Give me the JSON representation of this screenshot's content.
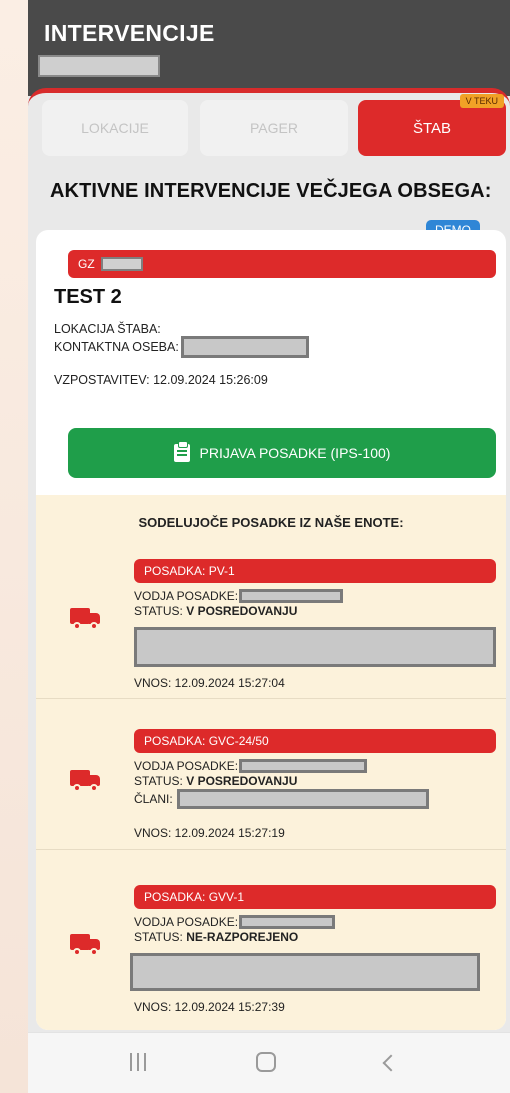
{
  "appbar": {
    "title": "INTERVENCIJE"
  },
  "tabs": [
    {
      "label": "LOKACIJE",
      "active": false
    },
    {
      "label": "PAGER",
      "active": false
    },
    {
      "label": "ŠTAB",
      "active": true,
      "badge": "V TEKU"
    }
  ],
  "section": {
    "title": "AKTIVNE INTERVENCIJE VEČJEGA OBSEGA:"
  },
  "intervention": {
    "badge": "DEMO",
    "gz_label": "GZ",
    "title": "TEST 2",
    "lokacija_label": "LOKACIJA ŠTABA:",
    "kontakt_label": "KONTAKTNA OSEBA:",
    "vzpostavitev": "VZPOSTAVITEV: 12.09.2024 15:26:09",
    "button_label": "PRIJAVA POSADKE (IPS-100)"
  },
  "crews": {
    "title": "SODELUJOČE POSADKE IZ NAŠE ENOTE:",
    "items": [
      {
        "posadka": "POSADKA: PV-1",
        "vodja_label": "VODJA POSADKE:",
        "status_label": "STATUS:",
        "status": "V POSREDOVANJU",
        "vnos": "VNOS: 12.09.2024 15:27:04"
      },
      {
        "posadka": "POSADKA: GVC-24/50",
        "vodja_label": "VODJA POSADKE:",
        "status_label": "STATUS:",
        "status": "V POSREDOVANJU",
        "clani_label": "ČLANI:",
        "vnos": "VNOS: 12.09.2024 15:27:19"
      },
      {
        "posadka": "POSADKA: GVV-1",
        "vodja_label": "VODJA POSADKE:",
        "status_label": "STATUS:",
        "status": "NE-RAZPOREJENO",
        "vnos": "VNOS: 12.09.2024 15:27:39"
      }
    ]
  },
  "colors": {
    "accent_red": "#dd2a2a",
    "green": "#1f9e4a",
    "demo_blue": "#2f86d6",
    "badge_orange": "#f1a126"
  },
  "navbar": {
    "icons": [
      "recent-apps-icon",
      "home-icon",
      "back-icon"
    ]
  }
}
